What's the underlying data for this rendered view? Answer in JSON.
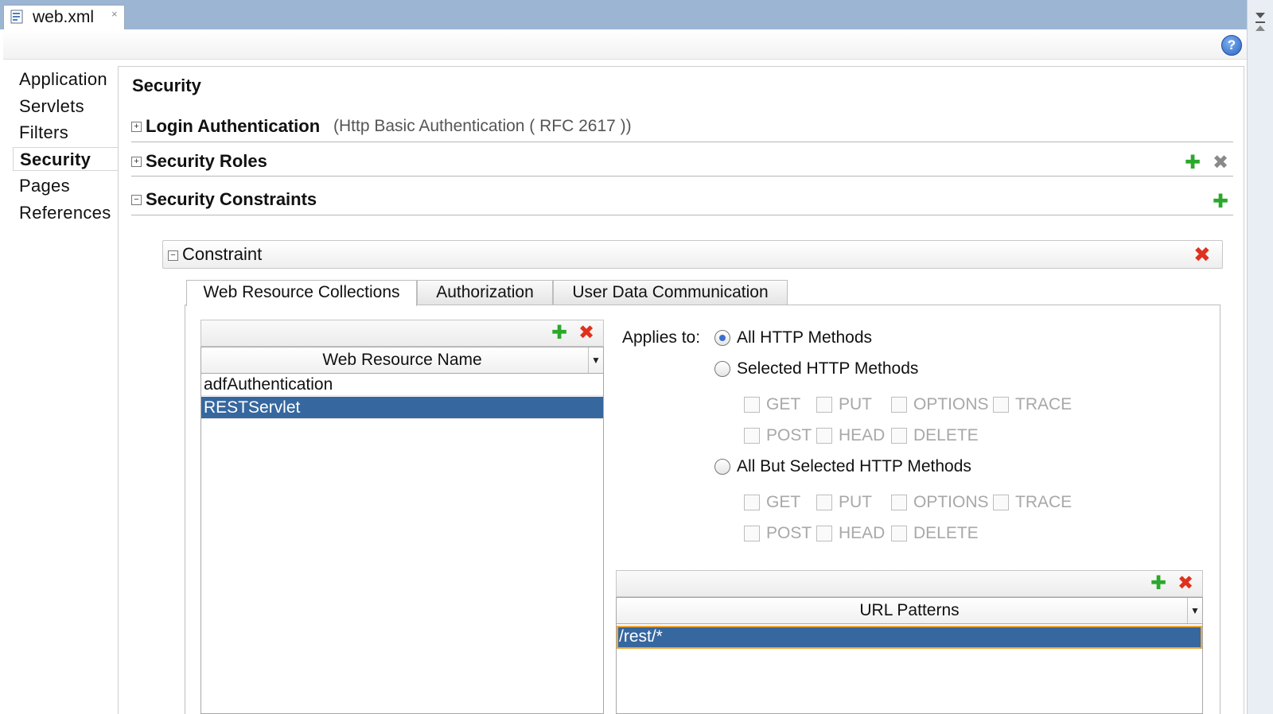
{
  "editor_tab": {
    "file_name": "web.xml",
    "close_glyph": "×"
  },
  "toolbar": {
    "help_glyph": "?"
  },
  "nav": {
    "items": [
      {
        "label": "Application"
      },
      {
        "label": "Servlets"
      },
      {
        "label": "Filters"
      },
      {
        "label": "Security",
        "selected": true
      },
      {
        "label": "Pages"
      },
      {
        "label": "References"
      }
    ]
  },
  "page": {
    "title": "Security"
  },
  "sections": {
    "login_auth": {
      "expander": "+",
      "label": "Login Authentication",
      "detail": "(Http Basic Authentication ( RFC 2617 ))"
    },
    "security_roles": {
      "expander": "+",
      "label": "Security Roles"
    },
    "security_constraints": {
      "expander": "−",
      "label": "Security Constraints"
    }
  },
  "icons": {
    "add": "✚",
    "remove": "✖",
    "dropdown": "▼"
  },
  "constraint": {
    "expander": "−",
    "label": "Constraint",
    "tabs": [
      {
        "label": "Web Resource Collections",
        "selected": true
      },
      {
        "label": "Authorization"
      },
      {
        "label": "User Data Communication"
      }
    ],
    "resources": {
      "header": "Web Resource Name",
      "rows": [
        {
          "name": "adfAuthentication",
          "selected": false
        },
        {
          "name": "RESTServlet",
          "selected": true
        }
      ]
    },
    "applies_to": {
      "label": "Applies to:",
      "options": [
        {
          "label": "All HTTP Methods",
          "selected": true
        },
        {
          "label": "Selected HTTP Methods",
          "selected": false
        },
        {
          "label": "All But Selected HTTP Methods",
          "selected": false
        }
      ],
      "methods_row1": [
        "GET",
        "PUT",
        "OPTIONS",
        "TRACE"
      ],
      "methods_row2": [
        "POST",
        "HEAD",
        "DELETE"
      ]
    },
    "url_patterns": {
      "header": "URL Patterns",
      "rows": [
        {
          "pattern": "/rest/*",
          "selected": true
        }
      ]
    }
  },
  "colors": {
    "selection": "#36679f",
    "add_green": "#2aa82a",
    "remove_red": "#e0301e",
    "focus_border": "#f0a838"
  }
}
